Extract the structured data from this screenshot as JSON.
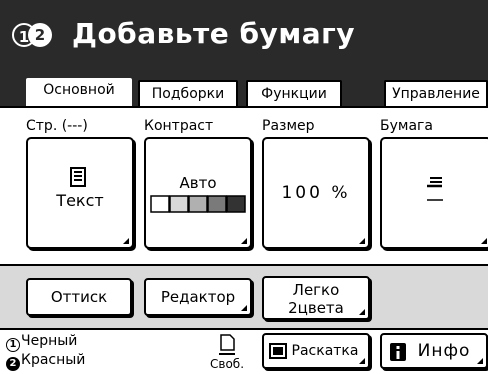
{
  "header": {
    "drum1": "1",
    "drum2": "2",
    "title": "Добавьте бумагу"
  },
  "tabs": [
    {
      "label": "Основной",
      "active": true
    },
    {
      "label": "Подборки",
      "active": false
    },
    {
      "label": "Функции",
      "active": false
    },
    {
      "label": "Управление",
      "active": false
    }
  ],
  "settings": {
    "page": {
      "label": "Стр. (---)",
      "value": "Текст"
    },
    "contrast": {
      "label": "Контраст",
      "value": "Авто",
      "levels": 5
    },
    "size": {
      "label": "Размер",
      "value": "100 %"
    },
    "paper": {
      "label": "Бумага"
    }
  },
  "actions": {
    "ottisk": "Оттиск",
    "editor": "Редактор",
    "two_color_l1": "Легко",
    "two_color_l2": "2цвета"
  },
  "status": {
    "drum1_num": "1",
    "drum1_color": "Черный",
    "drum2_num": "2",
    "drum2_color": "Красный",
    "free_label": "Своб.",
    "layout_button": "Раскатка",
    "info_button": "Инфо"
  },
  "colors": {
    "header_bg": "#2a2a2a",
    "bar_gray": "#d9d9d9"
  }
}
